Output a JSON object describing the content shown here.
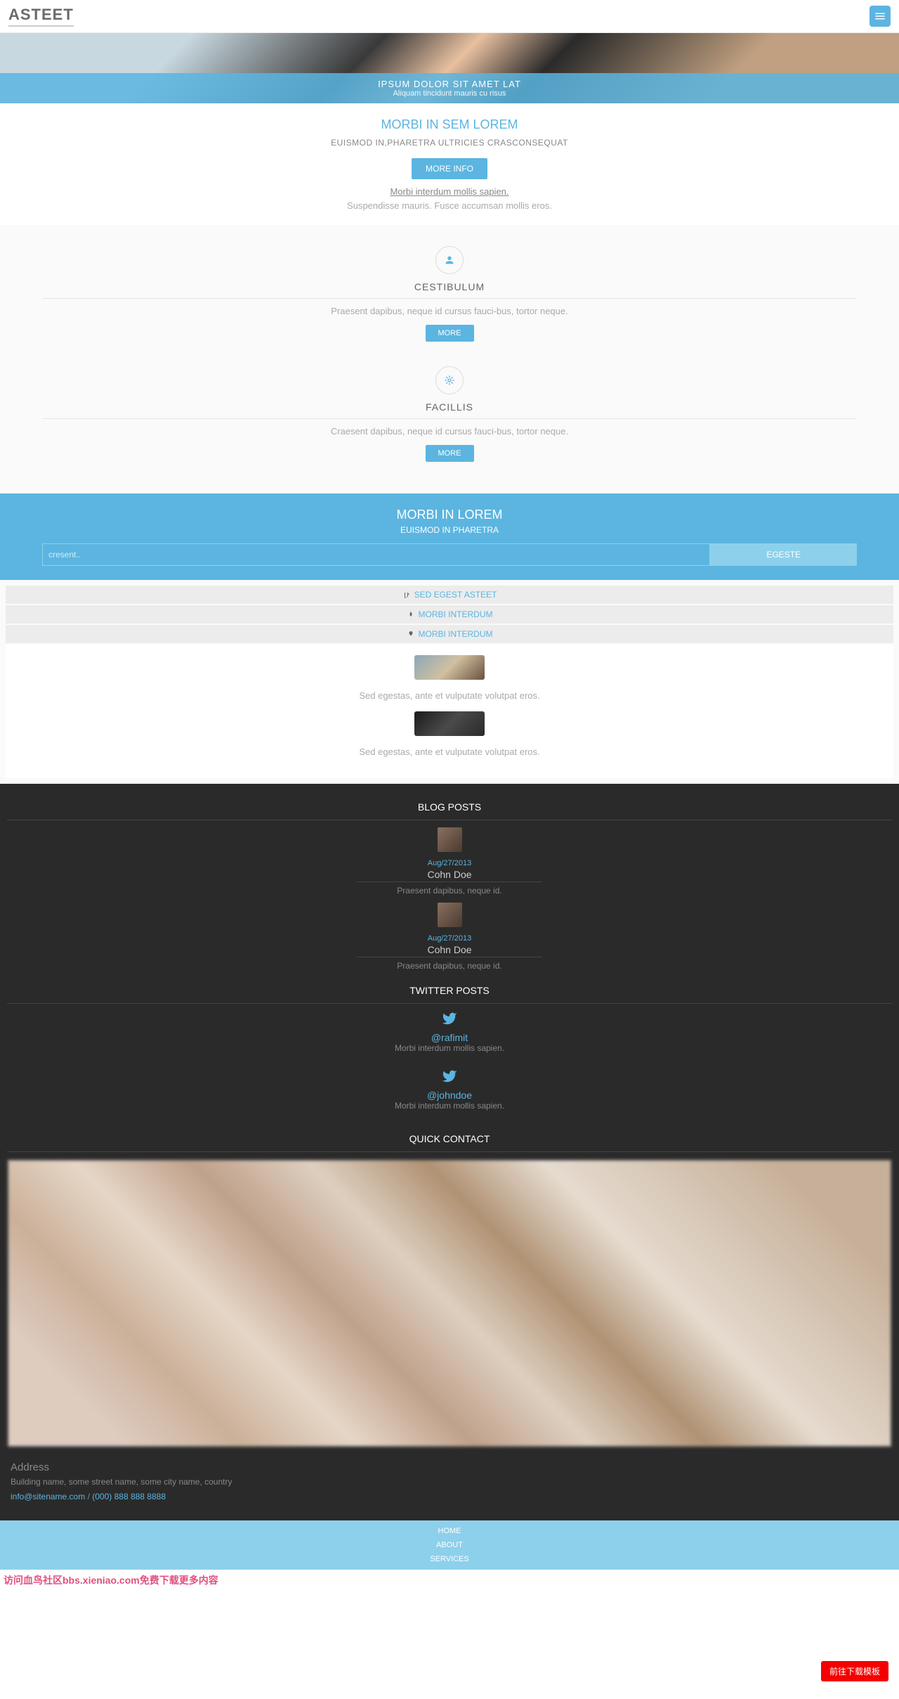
{
  "header": {
    "logo": "ASTEET"
  },
  "hero": {
    "title": "IPSUM DOLOR SIT AMET LAT",
    "subtitle": "Aliquam tincidunt mauris cu risus"
  },
  "intro": {
    "heading": "MORBI IN SEM LOREM",
    "subheading": "EUISMOD IN,PHARETRA ULTRICIES CRASCONSEQUAT",
    "button": "MORE INFO",
    "link": "Morbi interdum mollis sapien.",
    "text": "Suspendisse mauris. Fusce accumsan mollis eros."
  },
  "features": [
    {
      "title": "CESTIBULUM",
      "text": "Praesent dapibus, neque id cursus fauci-bus, tortor neque.",
      "button": "MORE"
    },
    {
      "title": "FACILLIS",
      "text": "Craesent dapibus, neque id cursus fauci-bus, tortor neque.",
      "button": "MORE"
    }
  ],
  "cta": {
    "title": "MORBI IN LOREM",
    "subtitle": "EUISMOD IN PHARETRA",
    "placeholder": "cresent..",
    "button": "EGESTE"
  },
  "tabs": [
    {
      "label": "SED EGEST ASTEET"
    },
    {
      "label": "MORBI INTERDUM"
    },
    {
      "label": "MORBI INTERDUM"
    }
  ],
  "tabContent": [
    {
      "text": "Sed egestas, ante et vulputate volutpat eros."
    },
    {
      "text": "Sed egestas, ante et vulputate volutpat eros."
    }
  ],
  "footer": {
    "blog": {
      "title": "BLOG POSTS",
      "posts": [
        {
          "date": "Aug/27/2013",
          "name": "Cohn Doe",
          "text": "Praesent dapibus, neque id."
        },
        {
          "date": "Aug/27/2013",
          "name": "Cohn Doe",
          "text": "Praesent dapibus, neque id."
        }
      ]
    },
    "twitter": {
      "title": "TWITTER POSTS",
      "posts": [
        {
          "handle": "@rafimit",
          "text": "Morbi interdum mollis sapien."
        },
        {
          "handle": "@johndoe",
          "text": "Morbi interdum mollis sapien."
        }
      ]
    },
    "contact": {
      "title": "QUICK CONTACT"
    },
    "address": {
      "title": "Address",
      "text": "Building name, some street name, some city name, country",
      "email": "info@sitename.com",
      "sep": " / ",
      "phone": "(000) 888 888 8888"
    }
  },
  "bottomNav": [
    "HOME",
    "ABOUT",
    "SERVICES"
  ],
  "redButton": "前往下载模板",
  "watermark": "访问血鸟社区bbs.xieniao.com免费下载更多内容"
}
